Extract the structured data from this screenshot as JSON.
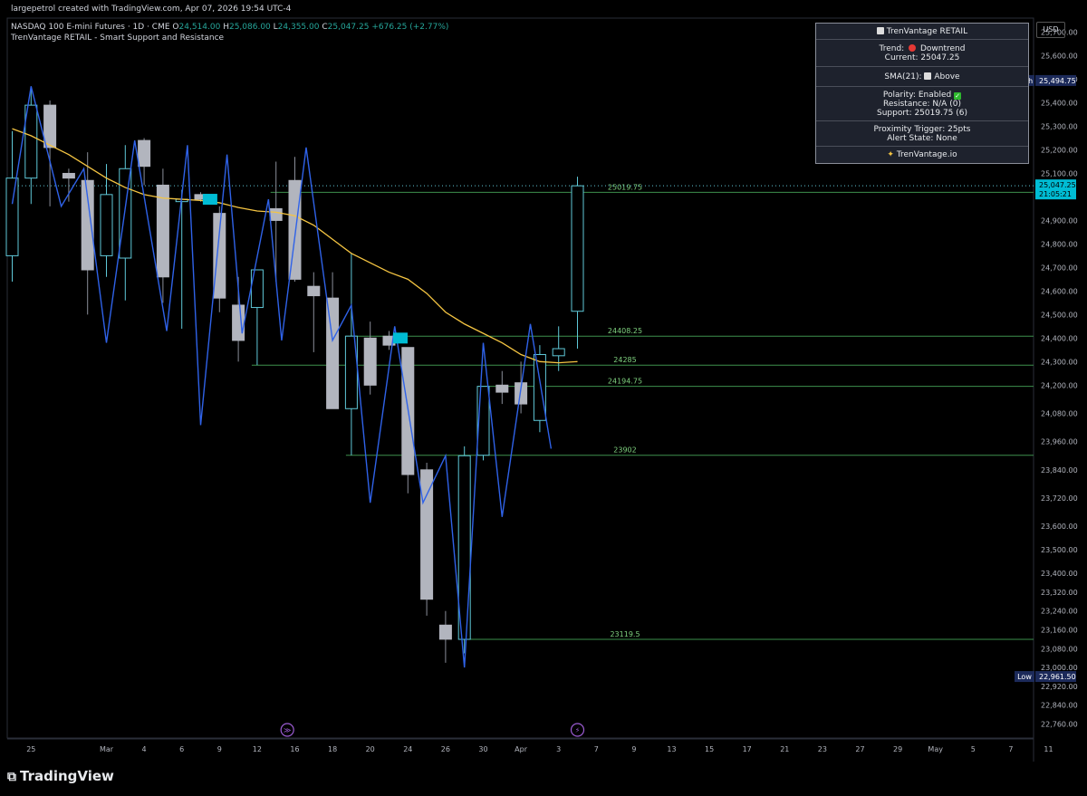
{
  "header": {
    "credit": "largepetrol created with TradingView.com, Apr 07, 2026 19:54 UTC-4",
    "symbol_title": "NASDAQ 100 E-mini Futures · 1D · CME",
    "open": "24,514.00",
    "high": "25,086.00",
    "low": "24,355.00",
    "close": "25,047.25",
    "change": "+676.25 (+2.77%)",
    "indicator": "TrenVantage RETAIL - Smart Support and Resistance"
  },
  "panel": {
    "title": "TrenVantage RETAIL",
    "trend_label": "Trend:",
    "trend_value": "Downtrend",
    "current": "Current: 25047.25",
    "sma": "SMA(21):",
    "sma_value": "Above",
    "polarity": "Polarity: Enabled",
    "resistance": "Resistance: N/A (0)",
    "support": "Support: 25019.75 (6)",
    "proximity": "Proximity Trigger: 25pts",
    "alert_state": "Alert State: None",
    "brand": "TrenVantage.io"
  },
  "currency": "USD",
  "footer": {
    "brand": "TradingView"
  },
  "colors": {
    "candle_up": "#5fc8d8",
    "candle_down": "#b2b5be",
    "zigzag": "#2f62e8",
    "sma": "#f5c542",
    "level": "#3d8f4d",
    "level_text": "#7fd17f",
    "highlight": "#00bcd4",
    "high_label_bg": "#1c2a5a",
    "price_tag_bg": "#00bcd4"
  },
  "chart_data": {
    "type": "candlestick",
    "ylim": [
      22700,
      25760
    ],
    "y_ticks": [
      25700,
      25600,
      25500,
      25400,
      25300,
      25200,
      25100,
      24900,
      24800,
      24700,
      24600,
      24500,
      24400,
      24300,
      24200,
      24080,
      23960,
      23840,
      23720,
      23600,
      23500,
      23400,
      23320,
      23240,
      23160,
      23080,
      23000,
      22920,
      22840,
      22760
    ],
    "y_tick_labels": [
      "25,700.00",
      "25,600.00",
      "25,500.00",
      "25,400.00",
      "25,300.00",
      "25,200.00",
      "25,100.00",
      "24,900.00",
      "24,800.00",
      "24,700.00",
      "24,600.00",
      "24,500.00",
      "24,400.00",
      "24,300.00",
      "24,200.00",
      "24,080.00",
      "23,960.00",
      "23,840.00",
      "23,720.00",
      "23,600.00",
      "23,500.00",
      "23,400.00",
      "23,320.00",
      "23,240.00",
      "23,160.00",
      "23,080.00",
      "23,000.00",
      "22,920.00",
      "22,840.00",
      "22,760.00"
    ],
    "x_tick_index": [
      1,
      5,
      7,
      9,
      11,
      13,
      15,
      17,
      19,
      21,
      23,
      25,
      27,
      29,
      31,
      33,
      35,
      37,
      39,
      41,
      43,
      45,
      47,
      49,
      51,
      53,
      55
    ],
    "x_tick_labels": [
      "25",
      "Mar",
      "4",
      "6",
      "9",
      "12",
      "16",
      "18",
      "20",
      "24",
      "26",
      "30",
      "Apr",
      "3",
      "7",
      "9",
      "13",
      "15",
      "17",
      "21",
      "23",
      "27",
      "29",
      "May",
      "5",
      "7",
      "11"
    ],
    "candles": [
      {
        "o": 24750,
        "h": 25280,
        "l": 24640,
        "c": 25080
      },
      {
        "o": 25080,
        "h": 25470,
        "l": 24970,
        "c": 25390
      },
      {
        "o": 25390,
        "h": 25410,
        "l": 24960,
        "c": 25210
      },
      {
        "o": 25100,
        "h": 25120,
        "l": 24980,
        "c": 25080
      },
      {
        "o": 25070,
        "h": 25190,
        "l": 24500,
        "c": 24690
      },
      {
        "o": 24750,
        "h": 25140,
        "l": 24660,
        "c": 25010
      },
      {
        "o": 24740,
        "h": 25220,
        "l": 24560,
        "c": 25120
      },
      {
        "o": 25240,
        "h": 25250,
        "l": 25050,
        "c": 25130
      },
      {
        "o": 25050,
        "h": 25120,
        "l": 24550,
        "c": 24660
      },
      {
        "o": 24980,
        "h": 25030,
        "l": 24440,
        "c": 24990
      },
      {
        "o": 25010,
        "h": 25020,
        "l": 24980,
        "c": 24990
      },
      {
        "o": 24930,
        "h": 24960,
        "l": 24510,
        "c": 24570
      },
      {
        "o": 24540,
        "h": 24660,
        "l": 24300,
        "c": 24390
      },
      {
        "o": 24530,
        "h": 24650,
        "l": 24285,
        "c": 24690
      },
      {
        "o": 24950,
        "h": 25150,
        "l": 24640,
        "c": 24900
      },
      {
        "o": 25070,
        "h": 25170,
        "l": 24640,
        "c": 24650
      },
      {
        "o": 24620,
        "h": 24680,
        "l": 24340,
        "c": 24580
      },
      {
        "o": 24570,
        "h": 24680,
        "l": 24180,
        "c": 24100
      },
      {
        "o": 24100,
        "h": 24760,
        "l": 23902,
        "c": 24408.25
      },
      {
        "o": 24400,
        "h": 24470,
        "l": 24160,
        "c": 24200
      },
      {
        "o": 24408,
        "h": 24430,
        "l": 24350,
        "c": 24370
      },
      {
        "o": 24360,
        "h": 24360,
        "l": 23740,
        "c": 23820
      },
      {
        "o": 23840,
        "h": 23870,
        "l": 23220,
        "c": 23290
      },
      {
        "o": 23180,
        "h": 23240,
        "l": 23020,
        "c": 23120
      },
      {
        "o": 23119.5,
        "h": 23940,
        "l": 23060,
        "c": 23900
      },
      {
        "o": 23902,
        "h": 24180,
        "l": 23880,
        "c": 24194.75
      },
      {
        "o": 24200,
        "h": 24260,
        "l": 24120,
        "c": 24170
      },
      {
        "o": 24210,
        "h": 24300,
        "l": 24080,
        "c": 24120
      },
      {
        "o": 24050,
        "h": 24370,
        "l": 24000,
        "c": 24330
      },
      {
        "o": 24325,
        "h": 24450,
        "l": 24260,
        "c": 24355
      },
      {
        "o": 24514,
        "h": 25086,
        "l": 24355,
        "c": 25047.25
      }
    ],
    "sma": [
      25290,
      25260,
      25220,
      25180,
      25130,
      25080,
      25040,
      25010,
      24995,
      24990,
      24985,
      24975,
      24955,
      24940,
      24935,
      24920,
      24880,
      24820,
      24760,
      24720,
      24680,
      24650,
      24590,
      24510,
      24460,
      24420,
      24380,
      24330,
      24300,
      24295,
      24300
    ],
    "zigzag": [
      {
        "i": 0,
        "p": 24970
      },
      {
        "i": 1,
        "p": 25470
      },
      {
        "i": 2.6,
        "p": 24960
      },
      {
        "i": 3.8,
        "p": 25120
      },
      {
        "i": 5,
        "p": 24380
      },
      {
        "i": 6.5,
        "p": 25240
      },
      {
        "i": 8.2,
        "p": 24430
      },
      {
        "i": 9.3,
        "p": 25220
      },
      {
        "i": 10,
        "p": 24030
      },
      {
        "i": 11.4,
        "p": 25180
      },
      {
        "i": 12.2,
        "p": 24420
      },
      {
        "i": 13.6,
        "p": 24990
      },
      {
        "i": 14.3,
        "p": 24390
      },
      {
        "i": 15.6,
        "p": 25210
      },
      {
        "i": 17,
        "p": 24390
      },
      {
        "i": 18,
        "p": 24540
      },
      {
        "i": 19,
        "p": 23700
      },
      {
        "i": 20.3,
        "p": 24450
      },
      {
        "i": 21.8,
        "p": 23700
      },
      {
        "i": 23,
        "p": 23900
      },
      {
        "i": 24,
        "p": 23000
      },
      {
        "i": 25,
        "p": 24380
      },
      {
        "i": 26,
        "p": 23640
      },
      {
        "i": 27.5,
        "p": 24460
      },
      {
        "i": 28.6,
        "p": 23930
      }
    ],
    "levels": [
      {
        "value": 25019.75,
        "label": "25019.75",
        "from": 14
      },
      {
        "value": 24408.25,
        "label": "24408.25",
        "from": 18
      },
      {
        "value": 24285,
        "label": "24285",
        "from": 13
      },
      {
        "value": 24194.75,
        "label": "24194.75",
        "from": 25
      },
      {
        "value": 23902,
        "label": "23902",
        "from": 18
      },
      {
        "value": 23119.5,
        "label": "23119.5",
        "from": 24
      }
    ],
    "markers": [
      {
        "i": 10.5,
        "p": 24990
      },
      {
        "i": 20.6,
        "p": 24400
      }
    ],
    "current_price": {
      "value": 25047.25,
      "label": "25,047.25",
      "countdown": "21:05:21"
    },
    "high_label": {
      "tag": "High",
      "value": 25494.75,
      "label": "25,494.75"
    },
    "low_label": {
      "tag": "Low",
      "value": 22961.5,
      "label": "22,961.50"
    },
    "event_icons": [
      {
        "i": 14.6,
        "glyph": "≫"
      },
      {
        "i": 30,
        "glyph": "⚡"
      }
    ]
  }
}
